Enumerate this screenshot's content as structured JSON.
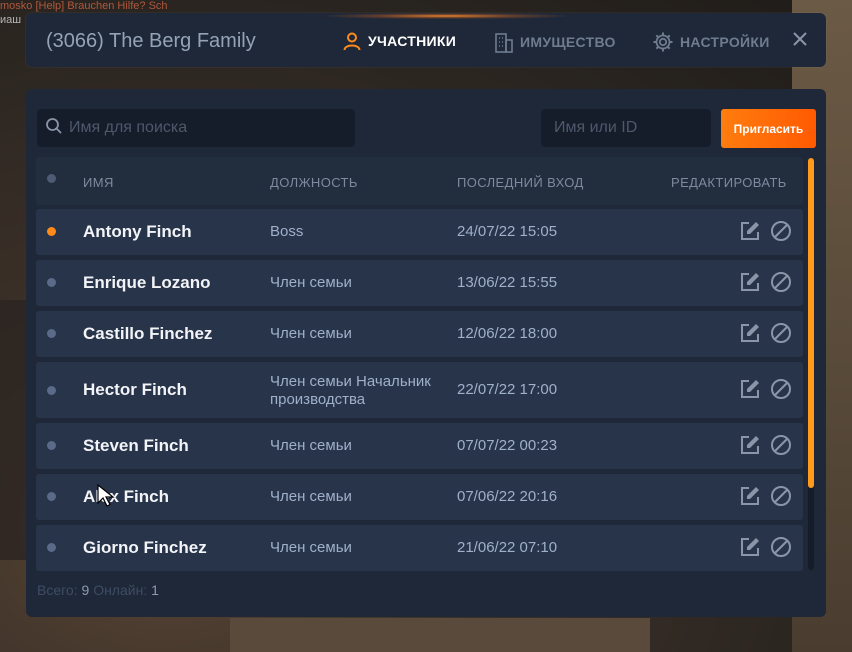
{
  "background": {
    "chat_line_1": "mosko [Help] Brauchen Hilfe? Sch",
    "chat_line_2": "иаш"
  },
  "header": {
    "title": "(3066) The Berg Family",
    "tabs": [
      {
        "label": "УЧАСТНИКИ",
        "icon": "user-icon",
        "active": true
      },
      {
        "label": "ИМУЩЕСТВО",
        "icon": "building-icon",
        "active": false
      },
      {
        "label": "НАСТРОЙКИ",
        "icon": "gear-icon",
        "active": false
      }
    ],
    "close_icon": "close-icon"
  },
  "toolbar": {
    "search_placeholder": "Имя для поиска",
    "search_value": "",
    "id_placeholder": "Имя или ID",
    "id_value": "",
    "invite_label": "Пригласить"
  },
  "table": {
    "headers": {
      "name": "ИМЯ",
      "rank": "ДОЛЖНОСТЬ",
      "last_login": "ПОСЛЕДНИЙ ВХОД",
      "edit": "РЕДАКТИРОВАТЬ"
    },
    "rows": [
      {
        "name": "Antony Finch",
        "rank": "Boss",
        "last_login": "24/07/22 15:05",
        "online": true
      },
      {
        "name": "Enrique Lozano",
        "rank": "Член семьи",
        "last_login": "13/06/22 15:55",
        "online": false
      },
      {
        "name": "Castillo Finchez",
        "rank": "Член семьи",
        "last_login": "12/06/22 18:00",
        "online": false
      },
      {
        "name": "Hector Finch",
        "rank": "Член семьи Начальник производства",
        "last_login": "22/07/22 17:00",
        "online": false
      },
      {
        "name": "Steven Finch",
        "rank": "Член семьи",
        "last_login": "07/07/22 00:23",
        "online": false
      },
      {
        "name": "Alex Finch",
        "rank": "Член семьи",
        "last_login": "07/06/22 20:16",
        "online": false
      },
      {
        "name": "Giorno Finchez",
        "rank": "Член семьи",
        "last_login": "21/06/22 07:10",
        "online": false
      }
    ],
    "row_action_icons": [
      "edit-icon",
      "block-icon"
    ]
  },
  "footer": {
    "total_label": "Всего:",
    "total_value": "9",
    "online_label": "Онлайн:",
    "online_value": "1"
  },
  "colors": {
    "accent": "#ff7d0f",
    "online_dot": "#ff8a1c",
    "offline_dot": "#5a6a88",
    "panel_bg": "#1e2838",
    "row_bg": "#28344a"
  },
  "scrollbar": {
    "visible_fraction": 0.8
  }
}
